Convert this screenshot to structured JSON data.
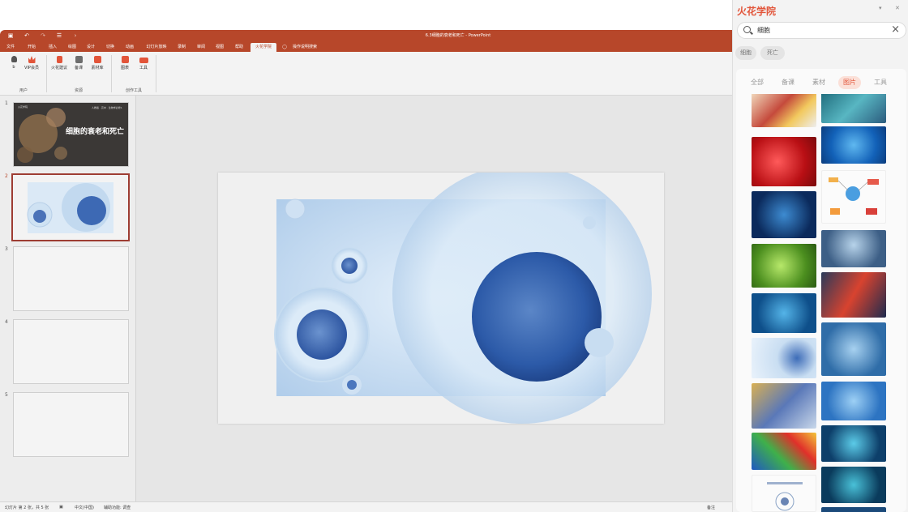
{
  "app": {
    "doc_title": "6.3细胞的衰老和死亡 - PowerPoint",
    "tabs": [
      "文件",
      "开始",
      "插入",
      "绘图",
      "设计",
      "切换",
      "动画",
      "幻灯片放映",
      "录制",
      "审阅",
      "视图",
      "帮助",
      "火花学院"
    ],
    "active_tab": "火花学院",
    "tell_me": "操作说明搜索"
  },
  "ribbon": {
    "buttons": [
      {
        "label": "b",
        "icon": "user-icon",
        "color": "#555555"
      },
      {
        "label": "VIP会员",
        "icon": "crown-icon",
        "color": "#e2553a"
      },
      {
        "label": "火花建议",
        "icon": "bulb-icon",
        "color": "#e2553a"
      },
      {
        "label": "备课",
        "icon": "doc-icon",
        "color": "#6d6d6d"
      },
      {
        "label": "素材库",
        "icon": "library-icon",
        "color": "#e2553a"
      },
      {
        "label": "图表",
        "icon": "chart-icon",
        "color": "#e2553a"
      },
      {
        "label": "工具",
        "icon": "toolbox-icon",
        "color": "#e2553a"
      }
    ],
    "groups": [
      "用户",
      "资源",
      "创作工具"
    ]
  },
  "thumbnails": {
    "numbers": [
      "1",
      "2",
      "3",
      "4",
      "5"
    ],
    "slide1_title": "细胞的衰老和死亡",
    "slide1_brand": "火花学院",
    "slide1_header": "人教版 · 高中 · 生物学必修1"
  },
  "status": {
    "slide_info": "幻灯片 第 2 张，共 5 张",
    "language": "中文(中国)",
    "accessibility": "辅助功能: 调查",
    "notes": "备注"
  },
  "panel": {
    "title": "火花学院",
    "search_value": "细胞",
    "chips": [
      "细胞",
      "死亡"
    ],
    "tabs": [
      "全部",
      "备课",
      "素材",
      "图片",
      "工具"
    ],
    "active_tab": "图片"
  },
  "colors": {
    "accent": "#e2553a",
    "ppt_red": "#b7472a"
  }
}
